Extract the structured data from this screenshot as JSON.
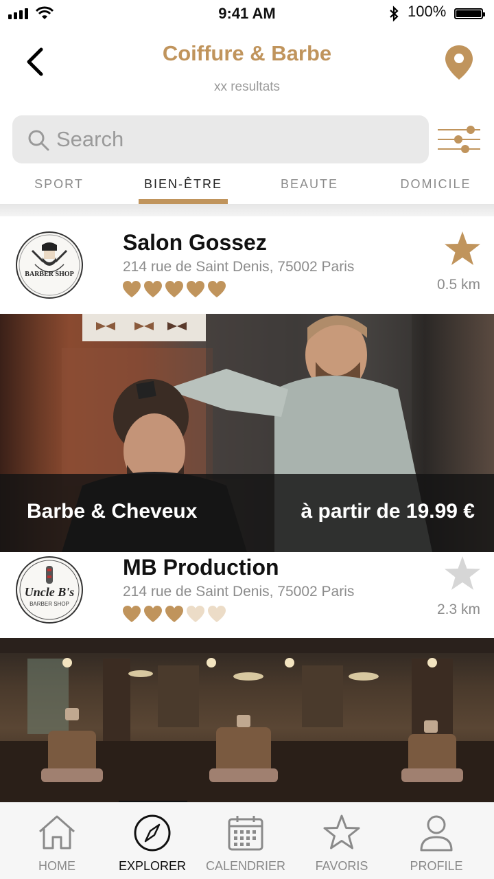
{
  "status_bar": {
    "time": "9:41 AM",
    "battery": "100%",
    "icons": [
      "signal-icon",
      "wifi-icon",
      "bluetooth-icon",
      "battery-icon"
    ]
  },
  "header": {
    "title": "Coiffure & Barbe",
    "subtitle": "xx resultats",
    "back_icon": "chevron-left-icon",
    "location_icon": "map-pin-icon"
  },
  "search": {
    "placeholder": "Search",
    "value": "",
    "filter_icon": "sliders-icon"
  },
  "tabs": {
    "items": [
      {
        "label": "SPORT"
      },
      {
        "label": "BIEN-ÊTRE"
      },
      {
        "label": "BEAUTE"
      },
      {
        "label": "DOMICILE"
      }
    ],
    "active_index": 1
  },
  "listings": [
    {
      "logo_text": "BARBER SHOP",
      "name": "Salon Gossez",
      "address": "214 rue de Saint Denis, 75002 Paris",
      "rating": 5,
      "rating_max": 5,
      "favorite": true,
      "distance": "0.5 km",
      "offer": {
        "label": "Barbe & Cheveux",
        "price": "à partir de 19.99 €"
      }
    },
    {
      "logo_text": "Uncle B's",
      "name": "MB Production",
      "address": "214 rue de Saint Denis, 75002 Paris",
      "rating": 3,
      "rating_max": 5,
      "favorite": false,
      "distance": "2.3 km"
    }
  ],
  "bottom_nav": {
    "items": [
      {
        "label": "HOME",
        "icon": "home-icon"
      },
      {
        "label": "EXPLORER",
        "icon": "compass-icon"
      },
      {
        "label": "CALENDRIER",
        "icon": "calendar-icon"
      },
      {
        "label": "FAVORIS",
        "icon": "star-outline-icon"
      },
      {
        "label": "PROFILE",
        "icon": "user-icon"
      }
    ],
    "active_index": 1
  },
  "colors": {
    "accent": "#c0945c",
    "accent_light": "#ecdcc7",
    "inactive_star": "#d6d6d6"
  }
}
